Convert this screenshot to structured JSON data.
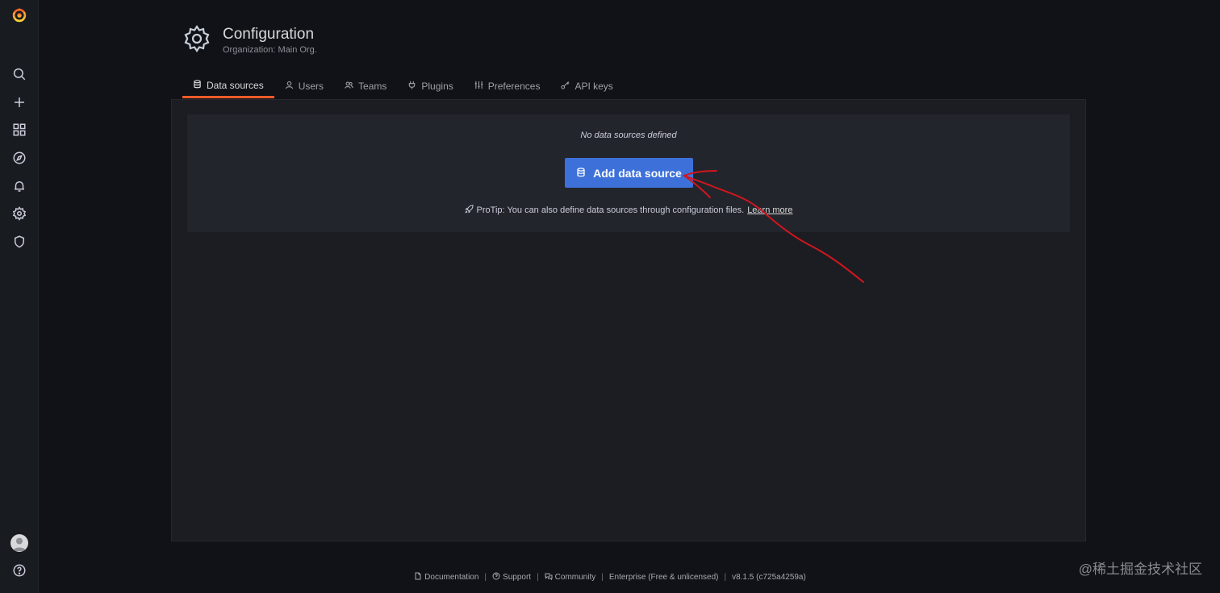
{
  "sidebar": {
    "logo": "grafana-logo",
    "items": [
      {
        "icon": "search-icon",
        "label": "Search"
      },
      {
        "icon": "plus-icon",
        "label": "Create"
      },
      {
        "icon": "dashboards-icon",
        "label": "Dashboards"
      },
      {
        "icon": "explore-icon",
        "label": "Explore"
      },
      {
        "icon": "bell-icon",
        "label": "Alerting"
      },
      {
        "icon": "gear-icon",
        "label": "Configuration"
      },
      {
        "icon": "shield-icon",
        "label": "Server Admin"
      }
    ],
    "bottom": [
      {
        "icon": "avatar"
      },
      {
        "icon": "help-icon"
      }
    ]
  },
  "header": {
    "title": "Configuration",
    "subtitle": "Organization: Main Org."
  },
  "tabs": [
    {
      "label": "Data sources",
      "icon": "database-icon",
      "active": true
    },
    {
      "label": "Users",
      "icon": "user-icon",
      "active": false
    },
    {
      "label": "Teams",
      "icon": "users-icon",
      "active": false
    },
    {
      "label": "Plugins",
      "icon": "plug-icon",
      "active": false
    },
    {
      "label": "Preferences",
      "icon": "sliders-icon",
      "active": false
    },
    {
      "label": "API keys",
      "icon": "key-icon",
      "active": false
    }
  ],
  "empty_state": {
    "message": "No data sources defined",
    "button_label": "Add data source",
    "protip_text": "ProTip: You can also define data sources through configuration files.",
    "learn_more": "Learn more"
  },
  "footer": {
    "documentation": "Documentation",
    "support": "Support",
    "community": "Community",
    "edition": "Enterprise (Free & unlicensed)",
    "version": "v8.1.5 (c725a4259a)",
    "separator": "|"
  },
  "watermark": "@稀土掘金技术社区",
  "colors": {
    "accent": "#f05a28",
    "primary_button": "#3d71d9",
    "annotation": "#d0161e"
  }
}
